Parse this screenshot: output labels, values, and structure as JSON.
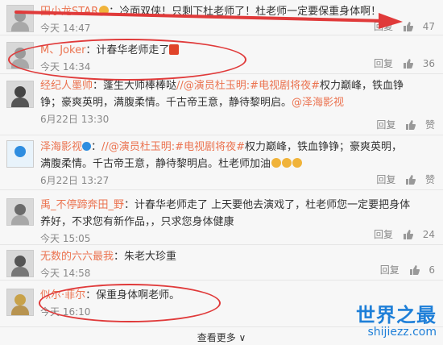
{
  "comments": [
    {
      "user": "田小龙STAR",
      "text": "：冷面双侠！只剩下杜老师了！杜老师一定要保重身体啊！",
      "time": "今天 14:47",
      "reply": "回复",
      "likes": "47"
    },
    {
      "user": "M、Joker",
      "text": "：计春华老师走了",
      "time": "今天 14:34",
      "reply": "回复",
      "likes": "36"
    },
    {
      "user": "经纪人墨帅",
      "text_pre": "：蓬生大师棒棒哒",
      "mention1": "//@演员杜玉明:",
      "tag": "#电视剧将夜#",
      "text_mid": "权力巅峰，铁血铮铮；豪爽英明，满腹柔情。千古帝王意，静待黎明启。",
      "mention2": "@泽海影视",
      "time": "6月22日 13:30",
      "reply": "回复",
      "likes": "赞"
    },
    {
      "user": "泽海影视",
      "text_pre": "：",
      "mention1": "//@演员杜玉明:",
      "tag": "#电视剧将夜#",
      "text_mid": "权力巅峰，铁血铮铮；豪爽英明，满腹柔情。千古帝王意，静待黎明启。杜老师加油",
      "time": "6月22日 13:27",
      "reply": "回复",
      "likes": "赞"
    },
    {
      "user": "禹_不停蹄奔田_野",
      "text": "：计春华老师走了 上天要他去演戏了，杜老师您一定要把身体养好，不求您有新作品，，只求您身体健康",
      "time": "今天 15:05",
      "reply": "回复",
      "likes": "24"
    },
    {
      "user": "无数的六六最我",
      "text": "：朱老大珍重",
      "time": "今天 14:58",
      "reply": "回复",
      "likes": "6"
    },
    {
      "user": "似尔·菲尔",
      "text": "：保重身体啊老师。",
      "time": "今天 16:10",
      "reply": "回复",
      "likes": ""
    }
  ],
  "more_label": "查看更多",
  "watermark": {
    "title": "世界之最",
    "url": "shijiezz.com"
  }
}
